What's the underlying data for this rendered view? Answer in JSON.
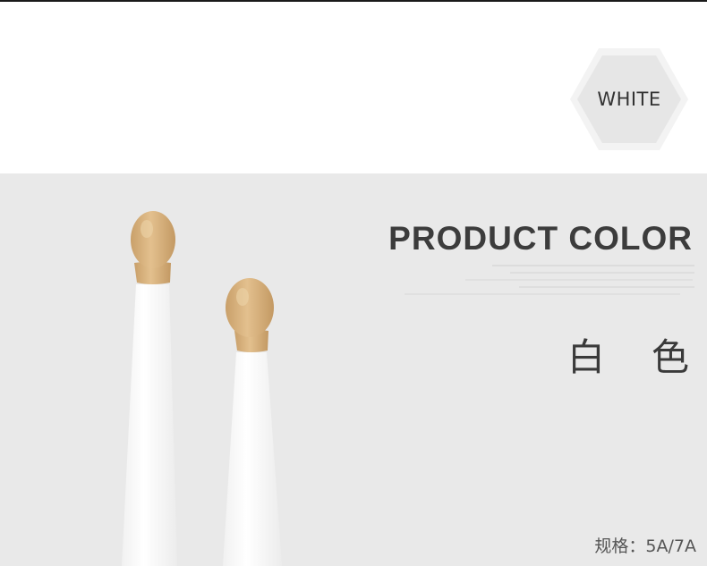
{
  "badge": {
    "label": "WHITE"
  },
  "product": {
    "heading": "PRODUCT COLOR",
    "color_name_cn": "白色",
    "spec_text": "规格：5A/7A",
    "stick_color": "white",
    "tip_color": "natural-wood"
  },
  "colors": {
    "section_bg": "#e9e9e9",
    "heading": "#3c3c3c",
    "badge_fill": "#e6e6e6",
    "stick_white": "#fafafa",
    "wood_tip": "#d9b27e"
  }
}
